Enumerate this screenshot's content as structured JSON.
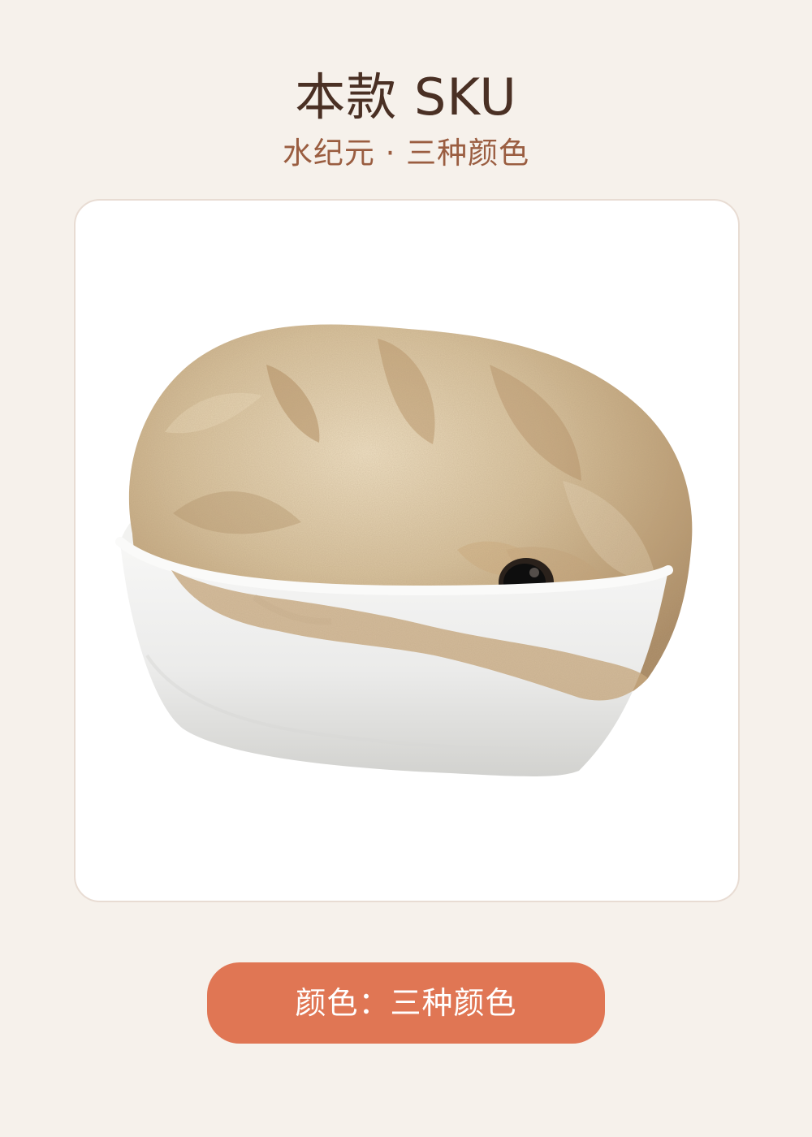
{
  "header": {
    "title": "本款 SKU",
    "subtitle": "水纪元 · 三种颜色"
  },
  "product": {
    "image_description_icon": "plush-hamster-in-white-bowl",
    "palette": {
      "fur_base": "#d8c29d",
      "fur_shadow": "#b89568",
      "fur_highlight": "#eddcbc",
      "bowl": "#ebebea",
      "bowl_shadow": "#d7d7d5",
      "eye": "#111111",
      "card_bg": "#ffffff"
    }
  },
  "color_option": {
    "label": "颜色：三种颜色",
    "button_color": "#e07654"
  }
}
